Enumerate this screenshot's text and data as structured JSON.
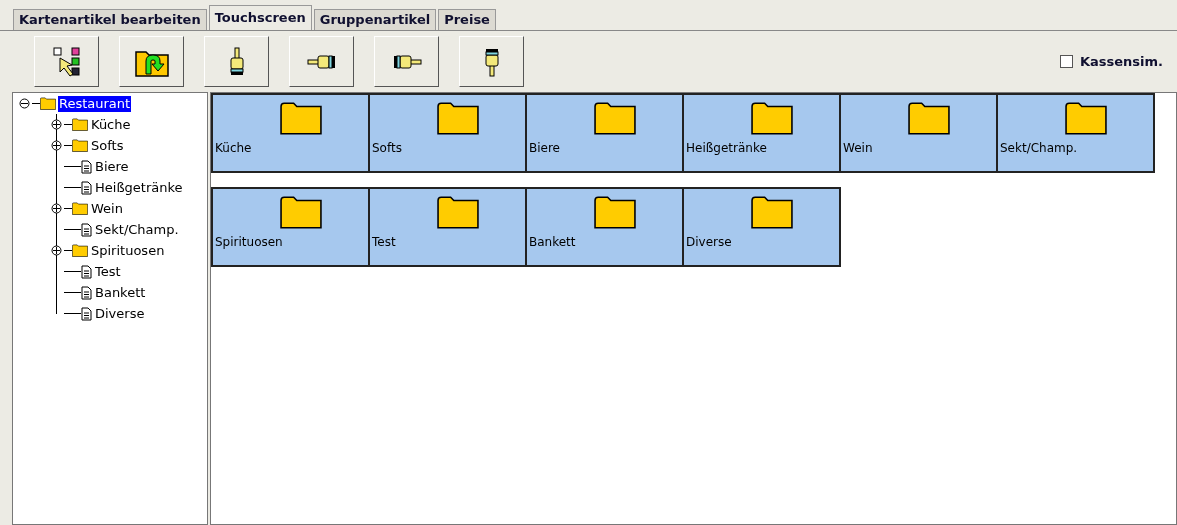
{
  "tabs": [
    {
      "label": "Kartenartikel bearbeiten",
      "selected": false
    },
    {
      "label": "Touchscreen",
      "selected": true
    },
    {
      "label": "Gruppenartikel",
      "selected": false
    },
    {
      "label": "Preise",
      "selected": false
    }
  ],
  "toolbar": {
    "buttons": [
      {
        "kind": "arrange"
      },
      {
        "kind": "folder-up"
      },
      {
        "kind": "hand-up"
      },
      {
        "kind": "hand-left"
      },
      {
        "kind": "hand-right"
      },
      {
        "kind": "hand-down"
      }
    ],
    "checkbox": {
      "label": "Kassensim.",
      "checked": false
    }
  },
  "tree": {
    "label": "Restaurant",
    "kind": "folder",
    "expanded": true,
    "selected": true,
    "children": [
      {
        "label": "Küche",
        "kind": "folder",
        "expanded": false,
        "selected": false
      },
      {
        "label": "Softs",
        "kind": "folder",
        "expanded": false,
        "selected": false
      },
      {
        "label": "Biere",
        "kind": "item",
        "selected": false
      },
      {
        "label": "Heißgetränke",
        "kind": "item",
        "selected": false
      },
      {
        "label": "Wein",
        "kind": "folder",
        "expanded": false,
        "selected": false
      },
      {
        "label": "Sekt/Champ.",
        "kind": "item",
        "selected": false
      },
      {
        "label": "Spirituosen",
        "kind": "folder",
        "expanded": false,
        "selected": false
      },
      {
        "label": "Test",
        "kind": "item",
        "selected": false
      },
      {
        "label": "Bankett",
        "kind": "item",
        "selected": false
      },
      {
        "label": "Diverse",
        "kind": "item",
        "selected": false
      }
    ]
  },
  "tile_rows": [
    [
      {
        "label": "Küche"
      },
      {
        "label": "Softs"
      },
      {
        "label": "Biere"
      },
      {
        "label": "Heißgetränke"
      },
      {
        "label": "Wein"
      },
      {
        "label": "Sekt/Champ."
      }
    ],
    [
      {
        "label": "Spirituosen"
      },
      {
        "label": "Test"
      },
      {
        "label": "Bankett"
      },
      {
        "label": "Diverse"
      }
    ]
  ]
}
